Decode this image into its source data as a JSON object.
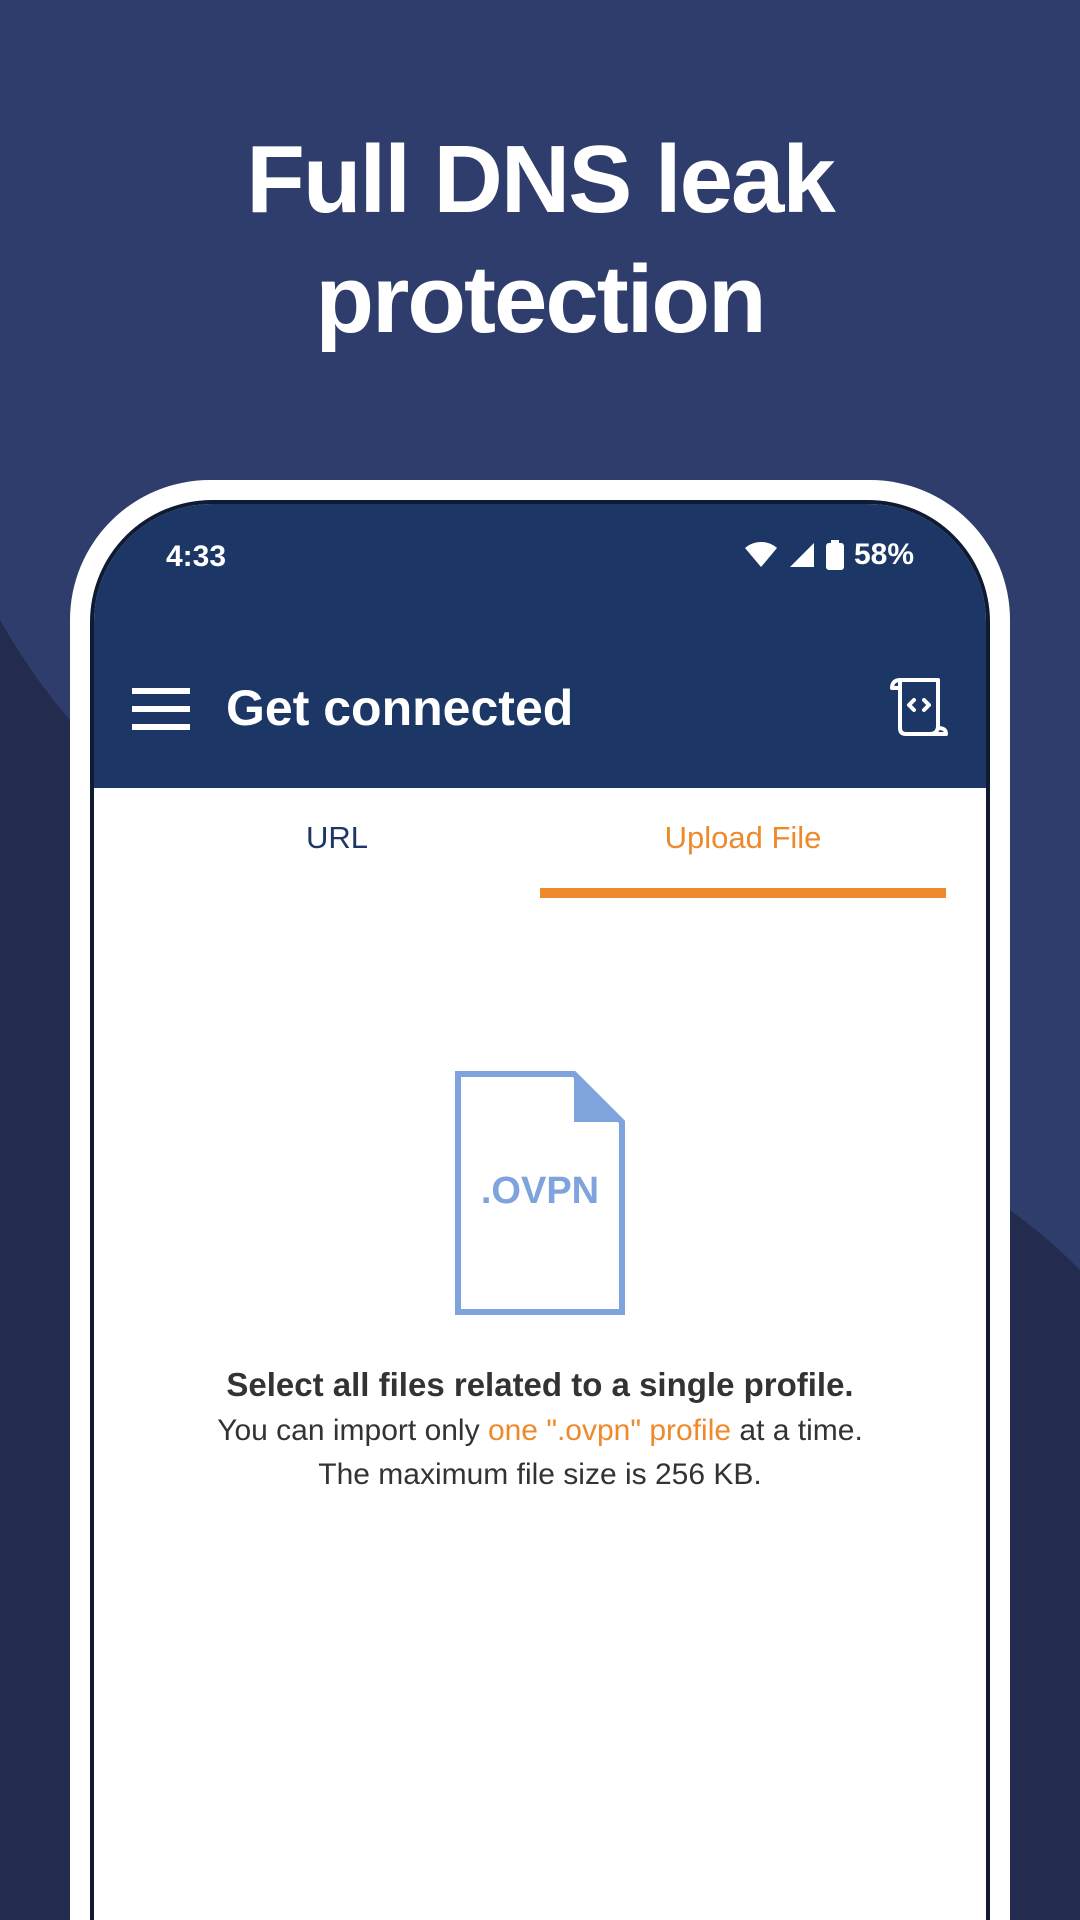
{
  "headline": {
    "line1": "Full DNS leak",
    "line2": "protection"
  },
  "status_bar": {
    "time": "4:33",
    "battery": "58%",
    "icons": [
      "wifi-icon",
      "cell-signal-icon",
      "battery-icon"
    ]
  },
  "toolbar": {
    "menu_icon": "hamburger-menu-icon",
    "title": "Get connected",
    "log_icon": "log-scroll-icon"
  },
  "tabs": [
    {
      "label": "URL",
      "selected": false
    },
    {
      "label": "Upload File",
      "selected": true
    }
  ],
  "upload": {
    "file_icon_label": ".OVPN",
    "title": "Select all files related to a single profile.",
    "line1_prefix": "You can import only ",
    "line1_highlight": "one \".ovpn\" profile",
    "line1_suffix": " at a time.",
    "line2": "The maximum file size is 256 KB."
  },
  "colors": {
    "background": "#2e3d6b",
    "appbar": "#1c3666",
    "accent": "#ee8a2c",
    "file_icon": "#7ea3dd",
    "text": "#333333"
  }
}
